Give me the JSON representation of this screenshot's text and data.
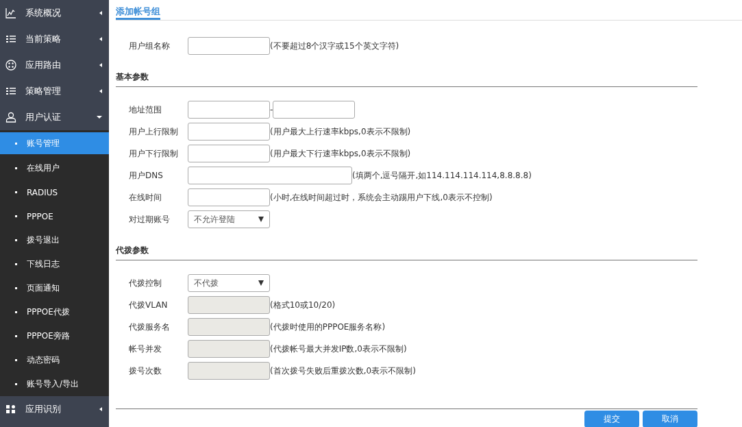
{
  "sidebar": {
    "items": [
      {
        "label": "系统概况",
        "kind": "chart",
        "expanded": false
      },
      {
        "label": "当前策略",
        "kind": "list",
        "expanded": false
      },
      {
        "label": "应用路由",
        "kind": "route",
        "expanded": false
      },
      {
        "label": "策略管理",
        "kind": "list",
        "expanded": false
      },
      {
        "label": "用户认证",
        "kind": "user",
        "expanded": true,
        "children": [
          {
            "label": "账号管理",
            "selected": true
          },
          {
            "label": "在线用户",
            "selected": false
          },
          {
            "label": "RADIUS",
            "selected": false
          },
          {
            "label": "PPPOE",
            "selected": false
          },
          {
            "label": "拨号退出",
            "selected": false
          },
          {
            "label": "下线日志",
            "selected": false
          },
          {
            "label": "页面通知",
            "selected": false
          },
          {
            "label": "PPPOE代拨",
            "selected": false
          },
          {
            "label": "PPPOE旁路",
            "selected": false
          },
          {
            "label": "动态密码",
            "selected": false
          },
          {
            "label": "账号导入/导出",
            "selected": false
          }
        ]
      },
      {
        "label": "应用识别",
        "kind": "apps",
        "expanded": false
      }
    ]
  },
  "tabs": [
    {
      "label": "添加帐号组",
      "selected": true
    }
  ],
  "sections": [
    {
      "fields": [
        {
          "label": "用户组名称",
          "kind": "text",
          "disabled": false,
          "hint": "(不要超过8个汉字或15个英文字符)"
        }
      ]
    },
    {
      "title": "基本参数",
      "fields": [
        {
          "label": "地址范围",
          "kind": "range",
          "disabled": false,
          "separator": "-"
        },
        {
          "label": "用户上行限制",
          "kind": "text",
          "disabled": false,
          "hint": "(用户最大上行速率kbps,0表示不限制)"
        },
        {
          "label": "用户下行限制",
          "kind": "text",
          "disabled": false,
          "hint": "(用户最大下行速率kbps,0表示不限制)"
        },
        {
          "label": "用户DNS",
          "kind": "wide",
          "disabled": false,
          "hint": "(填两个,逗号隔开,如114.114.114.114,8.8.8.8)"
        },
        {
          "label": "在线时间",
          "kind": "text",
          "disabled": false,
          "hint": "(小时,在线时间超过时，系统会主动踢用户下线,0表示不控制)"
        },
        {
          "label": "对过期账号",
          "kind": "select",
          "disabled": false,
          "value": "不允许登陆"
        }
      ]
    },
    {
      "title": "代拨参数",
      "fields": [
        {
          "label": "代拨控制",
          "kind": "select",
          "disabled": false,
          "value": "不代拨"
        },
        {
          "label": "代拨VLAN",
          "kind": "text",
          "disabled": true,
          "hint": "(格式10或10/20)"
        },
        {
          "label": "代拨服务名",
          "kind": "text",
          "disabled": true,
          "hint": "(代拨时使用的PPPOE服务名称)"
        },
        {
          "label": "帐号并发",
          "kind": "text",
          "disabled": true,
          "hint": "(代拨帐号最大并发IP数,0表示不限制)"
        },
        {
          "label": "拨号次数",
          "kind": "text",
          "disabled": true,
          "hint": "(首次拨号失败后重拨次数,0表示不限制)"
        }
      ]
    }
  ],
  "buttons": [
    "提交",
    "取消"
  ]
}
